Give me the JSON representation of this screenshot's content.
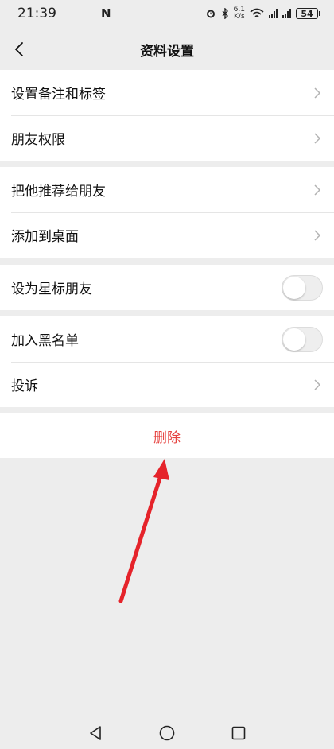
{
  "status_bar": {
    "time": "21:39",
    "nfc": "N",
    "net_speed_value": "6.1",
    "net_speed_unit": "K/s",
    "signal_label_1": "ııll",
    "signal_label_2": "ııll",
    "battery": "54"
  },
  "header": {
    "title": "资料设置"
  },
  "groups": [
    {
      "items": [
        {
          "label": "设置备注和标签"
        },
        {
          "label": "朋友权限"
        }
      ]
    },
    {
      "items": [
        {
          "label": "把他推荐给朋友"
        },
        {
          "label": "添加到桌面"
        }
      ]
    },
    {
      "items": [
        {
          "label": "设为星标朋友",
          "toggle": false
        }
      ]
    },
    {
      "items": [
        {
          "label": "加入黑名单",
          "toggle": false
        },
        {
          "label": "投诉"
        }
      ]
    }
  ],
  "delete": {
    "label": "删除"
  },
  "colors": {
    "background": "#ededed",
    "delete_text": "#e64340",
    "annotation_arrow": "#e5232a"
  }
}
